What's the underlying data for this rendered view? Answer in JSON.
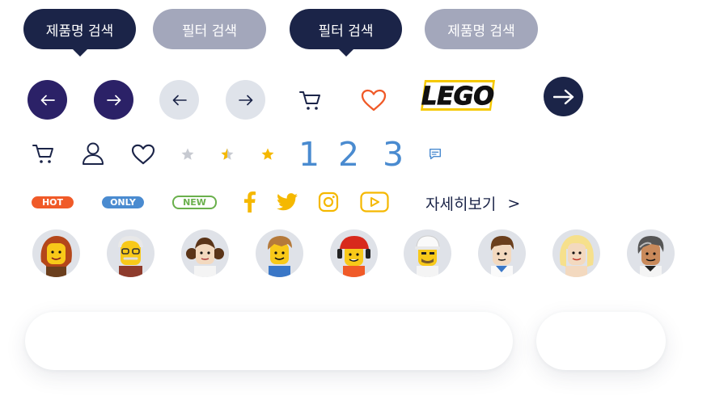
{
  "tooltips": [
    {
      "label": "제품명 검색",
      "style": "dark"
    },
    {
      "label": "필터 검색",
      "style": "grey"
    },
    {
      "label": "필터 검색",
      "style": "dark"
    },
    {
      "label": "제품명 검색",
      "style": "grey"
    }
  ],
  "icons": {
    "arrows": [
      "arrow-left-icon",
      "arrow-right-icon",
      "arrow-left-icon",
      "arrow-right-icon",
      "arrow-right-icon"
    ],
    "cart": "cart-icon",
    "heart": "heart-icon",
    "user": "user-icon",
    "stars": [
      "star-empty-icon",
      "star-half-icon",
      "star-full-icon"
    ],
    "social": [
      "facebook-icon",
      "twitter-icon",
      "instagram-icon",
      "youtube-icon"
    ],
    "chat": "chat-icon"
  },
  "logo": {
    "text": "LEGO"
  },
  "pagination": [
    "1",
    "2",
    "3"
  ],
  "badges": [
    {
      "text": "HOT",
      "color": "#f05a28"
    },
    {
      "text": "ONLY",
      "color": "#4a8bd0"
    },
    {
      "text": "NEW",
      "color": "#6ab04c"
    }
  ],
  "more_link": {
    "label": "자세히보기",
    "arrow": ">"
  },
  "avatars": [
    "minifig-red-hair",
    "minifig-glasses-grandpa",
    "minifig-leia-buns",
    "minifig-blond-boy",
    "minifig-construction-helmet",
    "minifig-white-cap",
    "minifig-brown-hair",
    "minifig-blonde-woman",
    "minifig-grey-hair"
  ],
  "colors": {
    "navy": "#1b2448",
    "indigo": "#2b2167",
    "grey_pill": "#a3a7bb",
    "light_circle": "#dfe3ea",
    "heart_orange": "#f05a28",
    "star_gold": "#f5b800",
    "social_gold": "#f5b800",
    "page_blue": "#4a8bd0"
  }
}
